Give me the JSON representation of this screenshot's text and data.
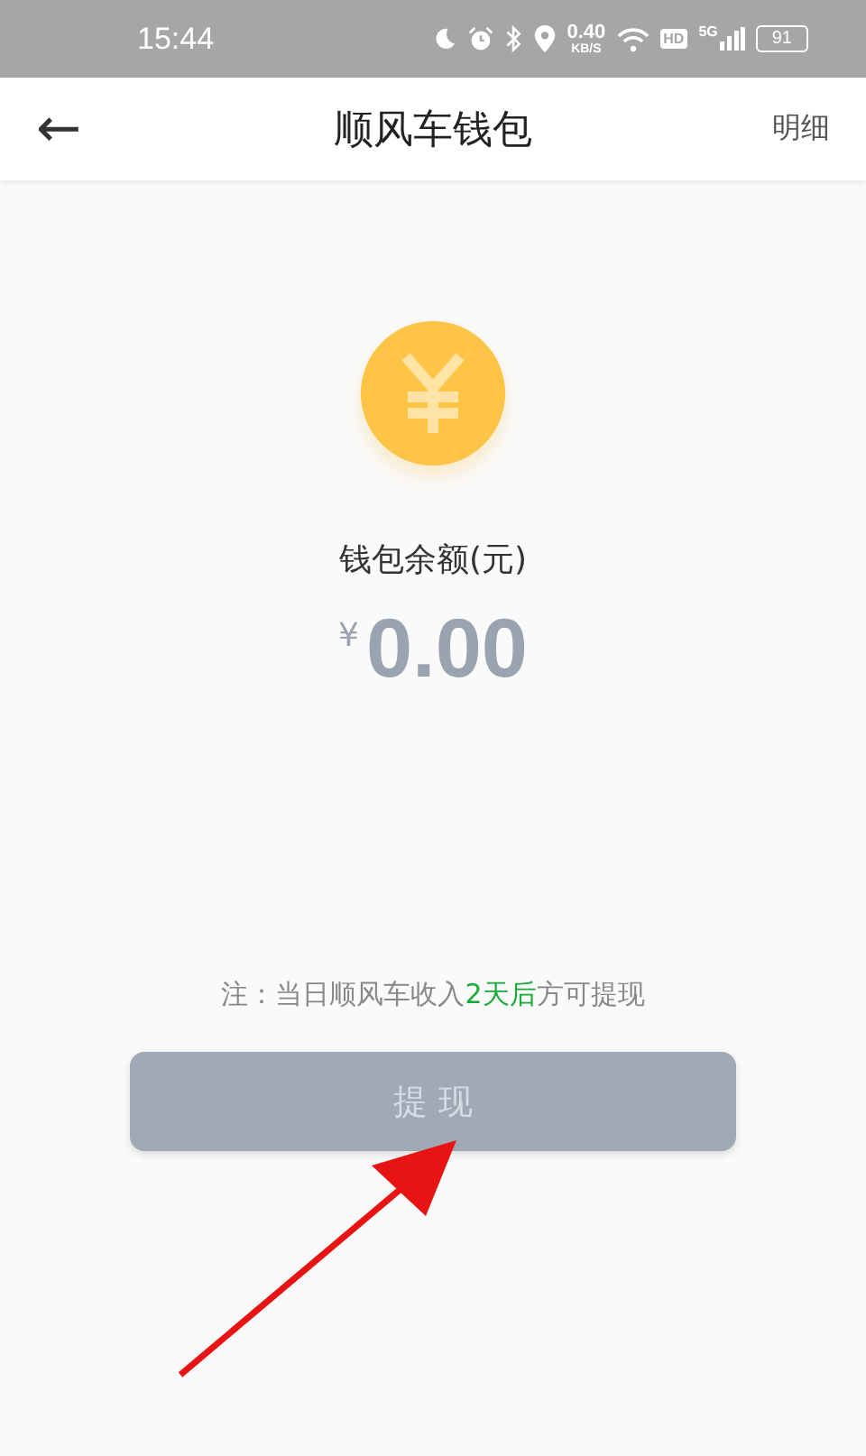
{
  "status_bar": {
    "time": "15:44",
    "speed": "0.40",
    "speed_unit": "KB/S",
    "hd": "HD",
    "network": "5G",
    "battery": "91"
  },
  "header": {
    "back": "←",
    "title": "顺风车钱包",
    "action": "明细"
  },
  "balance": {
    "label": "钱包余额(元)",
    "currency": "¥",
    "amount": "0.00"
  },
  "note": [
    {
      "kind": "plain",
      "text": "注：当日顺风车收入"
    },
    {
      "kind": "highlight",
      "text": "2天后"
    },
    {
      "kind": "plain",
      "text": "方可提现"
    }
  ],
  "withdraw_button": {
    "label": "提 现",
    "disabled": true
  }
}
